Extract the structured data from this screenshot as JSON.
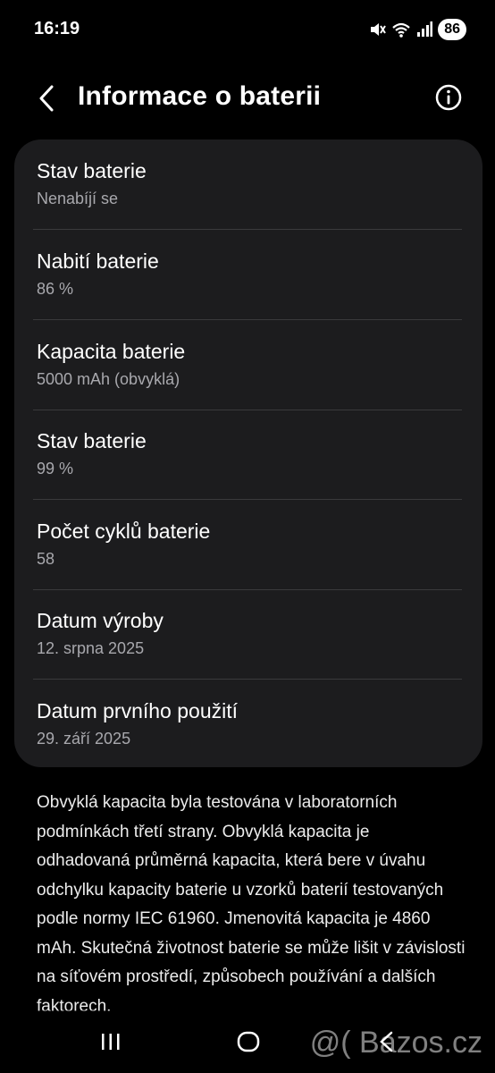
{
  "status_bar": {
    "time": "16:19",
    "battery_level": "86",
    "icons": [
      "mute-icon",
      "wifi-icon",
      "signal-icon"
    ]
  },
  "header": {
    "title": "Informace o baterii"
  },
  "rows": [
    {
      "label": "Stav baterie",
      "value": "Nenabíjí se"
    },
    {
      "label": "Nabití baterie",
      "value": "86 %"
    },
    {
      "label": "Kapacita baterie",
      "value": "5000 mAh (obvyklá)"
    },
    {
      "label": "Stav baterie",
      "value": "99 %"
    },
    {
      "label": "Počet cyklů baterie",
      "value": "58"
    },
    {
      "label": "Datum výroby",
      "value": "12. srpna 2025"
    },
    {
      "label": "Datum prvního použití",
      "value": "29. září 2025"
    }
  ],
  "footnote": "Obvyklá kapacita byla testována v laboratorních podmínkách třetí strany. Obvyklá kapacita je odhadovaná průměrná kapacita, která bere v úvahu odchylku kapacity baterie u vzorků baterií testovaných podle normy IEC 61960. Jmenovitá kapacita je 4860 mAh. Skutečná životnost baterie se může lišit v závislosti na síťovém prostředí, způsobech používání a dalších faktorech.",
  "watermark": "@( Bazos.cz",
  "colors": {
    "background": "#000000",
    "card": "#1c1c1e",
    "secondary_text": "#a8a8ad",
    "divider": "#3a3a3c"
  }
}
